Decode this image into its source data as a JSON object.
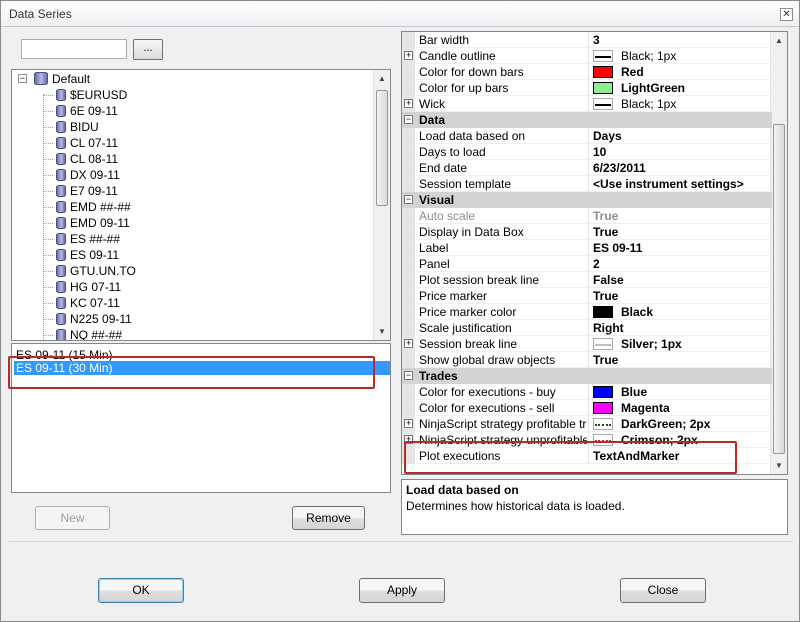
{
  "window": {
    "title": "Data Series",
    "close_glyph": "✕"
  },
  "search": {
    "placeholder": "",
    "value": "",
    "browse_label": "..."
  },
  "tree": {
    "root": "Default",
    "items": [
      "$EURUSD",
      "6E 09-11",
      "BIDU",
      "CL 07-11",
      "CL 08-11",
      "DX 09-11",
      "E7 09-11",
      "EMD ##-##",
      "EMD 09-11",
      "ES ##-##",
      "ES 09-11",
      "GTU.UN.TO",
      "HG 07-11",
      "KC 07-11",
      "N225 09-11",
      "NQ ##-##"
    ]
  },
  "series": {
    "items": [
      {
        "label": "ES 09-11 (15 Min)",
        "selected": false
      },
      {
        "label": "ES 09-11 (30 Min)",
        "selected": true
      }
    ]
  },
  "buttons": {
    "new": "New",
    "remove": "Remove",
    "ok": "OK",
    "apply": "Apply",
    "close": "Close"
  },
  "grid": {
    "rows": [
      {
        "kind": "prop",
        "name": "Bar width",
        "value": "3",
        "bold": true
      },
      {
        "kind": "prop",
        "name": "Candle outline",
        "value": "Black; 1px",
        "expand": true,
        "swatch": "line",
        "color": "#000000"
      },
      {
        "kind": "prop",
        "name": "Color for down bars",
        "value": "Red",
        "bold": true,
        "swatch": "fill",
        "color": "#ff0000"
      },
      {
        "kind": "prop",
        "name": "Color for up bars",
        "value": "LightGreen",
        "bold": true,
        "swatch": "fill",
        "color": "#90ee90"
      },
      {
        "kind": "prop",
        "name": "Wick",
        "value": "Black; 1px",
        "expand": true,
        "swatch": "line",
        "color": "#000000"
      },
      {
        "kind": "cat",
        "name": "Data"
      },
      {
        "kind": "prop",
        "name": "Load data based on",
        "value": "Days",
        "bold": true
      },
      {
        "kind": "prop",
        "name": "Days to load",
        "value": "10",
        "bold": true
      },
      {
        "kind": "prop",
        "name": "End date",
        "value": "6/23/2011",
        "bold": true
      },
      {
        "kind": "prop",
        "name": "Session template",
        "value": "<Use instrument settings>",
        "bold": true
      },
      {
        "kind": "cat",
        "name": "Visual"
      },
      {
        "kind": "prop",
        "name": "Auto scale",
        "value": "True",
        "bold": true,
        "disabled": true
      },
      {
        "kind": "prop",
        "name": "Display in Data Box",
        "value": "True",
        "bold": true
      },
      {
        "kind": "prop",
        "name": "Label",
        "value": "ES 09-11",
        "bold": true
      },
      {
        "kind": "prop",
        "name": "Panel",
        "value": "2",
        "bold": true
      },
      {
        "kind": "prop",
        "name": "Plot session break line",
        "value": "False",
        "bold": true
      },
      {
        "kind": "prop",
        "name": "Price marker",
        "value": "True",
        "bold": true
      },
      {
        "kind": "prop",
        "name": "Price marker color",
        "value": "Black",
        "bold": true,
        "swatch": "fill",
        "color": "#000000"
      },
      {
        "kind": "prop",
        "name": "Scale justification",
        "value": "Right",
        "bold": true
      },
      {
        "kind": "prop",
        "name": "Session break line",
        "value": "Silver; 1px",
        "bold": true,
        "expand": true,
        "swatch": "line",
        "color": "#c0c0c0"
      },
      {
        "kind": "prop",
        "name": "Show global draw objects",
        "value": "True",
        "bold": true
      },
      {
        "kind": "cat",
        "name": "Trades"
      },
      {
        "kind": "prop",
        "name": "Color for executions - buy",
        "value": "Blue",
        "bold": true,
        "swatch": "fill",
        "color": "#0000ff"
      },
      {
        "kind": "prop",
        "name": "Color for executions - sell",
        "value": "Magenta",
        "bold": true,
        "swatch": "fill",
        "color": "#ff00ff"
      },
      {
        "kind": "prop",
        "name": "NinjaScript strategy profitable trad",
        "value": "DarkGreen; 2px",
        "bold": true,
        "expand": true,
        "swatch": "dotted",
        "color": "#006400"
      },
      {
        "kind": "prop",
        "name": "NinjaScript strategy unprofitable tr",
        "value": "Crimson; 2px",
        "bold": true,
        "expand": true,
        "swatch": "dotted",
        "color": "#dc143c"
      },
      {
        "kind": "prop",
        "name": "Plot executions",
        "value": "TextAndMarker",
        "bold": true
      }
    ]
  },
  "description": {
    "title": "Load data based on",
    "text": "Determines how historical data is loaded."
  },
  "colors": {
    "highlight": "#b92b2b",
    "selection": "#3399ff"
  }
}
